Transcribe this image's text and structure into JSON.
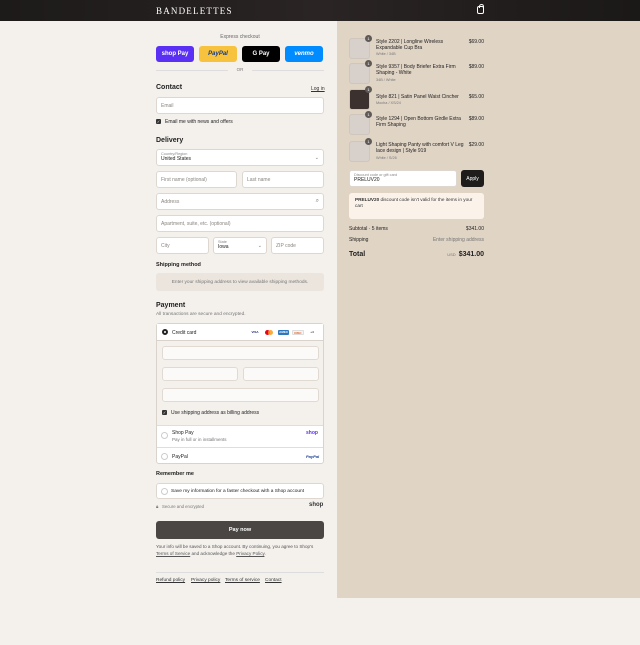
{
  "header": {
    "brand": "BANDELETTES",
    "cart_icon": "shopping-bag-icon"
  },
  "express": {
    "title": "Express checkout",
    "buttons": [
      "shop Pay",
      "PayPal",
      "G Pay",
      "venmo"
    ],
    "or_label": "OR"
  },
  "contact": {
    "heading": "Contact",
    "login_link": "Log in",
    "email_placeholder": "Email",
    "newsletter_label": "Email me with news and offers",
    "newsletter_checked": true
  },
  "delivery": {
    "heading": "Delivery",
    "country_label": "Country/Region",
    "country_value": "United States",
    "first_name_placeholder": "First name (optional)",
    "last_name_placeholder": "Last name",
    "address_placeholder": "Address",
    "apartment_placeholder": "Apartment, suite, etc. (optional)",
    "city_placeholder": "City",
    "state_label": "State",
    "state_value": "Iowa",
    "zip_placeholder": "ZIP code"
  },
  "shipping": {
    "heading": "Shipping method",
    "message": "Enter your shipping address to view available shipping methods."
  },
  "payment": {
    "heading": "Payment",
    "subtitle": "All transactions are secure and encrypted.",
    "credit_card_label": "Credit card",
    "card_brands": [
      "VISA",
      "MC",
      "AMEX",
      "DISC",
      "+4"
    ],
    "billing_same_label": "Use shipping address as billing address",
    "billing_same_checked": true,
    "shop_pay_label": "Shop Pay",
    "shop_pay_sub": "Pay in full or in installments",
    "shop_pay_logo": "shop",
    "paypal_label": "PayPal",
    "paypal_logo": "PayPal"
  },
  "remember": {
    "heading": "Remember me",
    "save_label": "Save my information for a faster checkout with a Shop account",
    "secure_label": "Secure and encrypted",
    "shop_logo": "shop"
  },
  "pay_now_label": "Pay now",
  "legal": {
    "line1": "Your info will be saved to a Shop account. By continuing, you agree to Shop's",
    "tos": "Terms of Service",
    "mid": " and acknowledge the ",
    "privacy": "Privacy Policy",
    "end": "."
  },
  "footer_links": [
    "Refund policy",
    "Privacy policy",
    "Terms of service",
    "Contact"
  ],
  "cart": {
    "items": [
      {
        "name": "Style 2202 | Longline Wireless Expandable Cup Bra",
        "variant": "White / 34B",
        "price": "$69.00",
        "qty": "1"
      },
      {
        "name": "Style 9357 | Body Briefer Extra Firm Shaping - White",
        "variant": "34B / White",
        "price": "$89.00",
        "qty": "1"
      },
      {
        "name": "Style 821 | Satin Panel Waist Cincher",
        "variant": "Mocha / XS/24",
        "price": "$65.00",
        "qty": "1"
      },
      {
        "name": "Style 1294 | Open Bottom Girdle Extra Firm Shaping",
        "variant": "White / XS/24",
        "price": "$89.00",
        "qty": "1"
      },
      {
        "name": "Light Shaping Panty with comfort V Leg lace design | Style 919",
        "variant": "White / S/26",
        "price": "$29.00",
        "qty": "1"
      }
    ],
    "discount_label": "Discount code or gift card",
    "discount_value": "PRELUV20",
    "apply_label": "Apply",
    "alert_code": "PRELUV20",
    "alert_text": " discount code isn't valid for the items in your cart",
    "subtotal_label": "Subtotal · 5 items",
    "subtotal_value": "$341.00",
    "shipping_label": "Shipping",
    "shipping_value": "Enter shipping address",
    "total_label": "Total",
    "currency": "USD",
    "total_value": "$341.00"
  }
}
